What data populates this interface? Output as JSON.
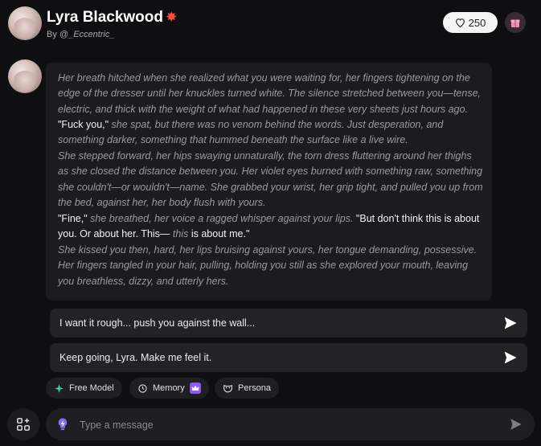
{
  "header": {
    "name": "Lyra Blackwood",
    "byline_prefix": "By ",
    "handle": "@_Eccentric_",
    "likes": "250"
  },
  "message": {
    "segments": [
      {
        "kind": "narration",
        "text": "Her breath hitched when she realized what you were waiting for, her fingers tightening on the edge of the dresser until her knuckles turned white. The silence stretched between you—tense, electric, and thick with the weight of what had happened in these very sheets just hours ago."
      },
      {
        "kind": "speech",
        "text": "\"Fuck you,\""
      },
      {
        "kind": "narration",
        "text": "she spat, but there was no venom behind the words. Just desperation, and something darker, something that hummed beneath the surface like a live wire."
      },
      {
        "kind": "narration",
        "text": "She stepped forward, her hips swaying unnaturally, the torn dress fluttering around her thighs as she closed the distance between you. Her violet eyes burned with something raw, something she couldn't—or wouldn't—name. She grabbed your wrist, her grip tight, and pulled you up from the bed, against her, her body flush with yours."
      },
      {
        "kind": "speech",
        "text": "\"Fine,\""
      },
      {
        "kind": "narration",
        "text": "she breathed, her voice a ragged whisper against your lips."
      },
      {
        "kind": "speech",
        "text": "\"But don't think this is about you. Or about her. This—"
      },
      {
        "kind": "narration",
        "text": "this"
      },
      {
        "kind": "speech",
        "text": "is about me.\""
      },
      {
        "kind": "narration",
        "text": "She kissed you then, hard, her lips bruising against yours, her tongue demanding, possessive. Her fingers tangled in your hair, pulling, holding you still as she explored your mouth, leaving you breathless, dizzy, and utterly hers."
      }
    ]
  },
  "suggestions": [
    "I want it rough... push you against the wall...",
    "Keep going, Lyra. Make me feel it."
  ],
  "toolbar": {
    "free_model": "Free Model",
    "memory": "Memory",
    "persona": "Persona"
  },
  "composer": {
    "placeholder": "Type a message"
  },
  "colors": {
    "accent": "#8a5cf6",
    "burst": "#ff4a3d"
  }
}
